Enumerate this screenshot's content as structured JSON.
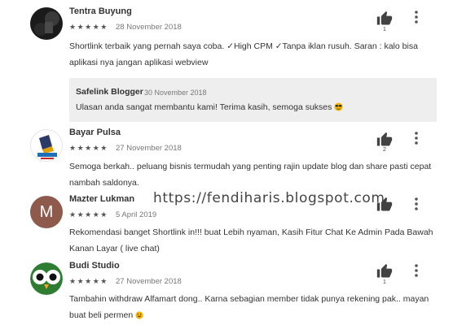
{
  "reviews": [
    {
      "name": "Tentra Buyung",
      "stars": "★★★★★",
      "date": "28 November 2018",
      "text": "Shortlink terbaik yang pernah saya coba. ✓High CPM ✓Tanpa iklan rusuh. Saran : kalo bisa aplikasi nya jangan aplikasi webview",
      "likes": "1",
      "avatar_icon": "dark-photo-avatar"
    },
    {
      "name": "Bayar Pulsa",
      "stars": "★★★★★",
      "date": "27 November 2018",
      "text": "Semoga berkah.. peluang bisnis termudah yang penting rajin update blog dan share pasti cepat nambah saldonya.",
      "likes": "2",
      "avatar_icon": "bayar-pulsa-logo-avatar"
    },
    {
      "name": "Mazter Lukman",
      "stars": "★★★★★",
      "date": "5 April 2019",
      "text": "Rekomendasi banget Shortlink in!!! buat Lebih nyaman, Kasih Fitur Chat Ke Admin Pada Bawah Kanan Layar ( live chat)",
      "likes": "",
      "avatar_letter": "M",
      "avatar_color": "#8d5a4c"
    },
    {
      "name": "Budi Studio",
      "stars": "★★★★★",
      "date": "27 November 2018",
      "text": "Tambahin withdraw Alfamart dong.. Karna sebagian member tidak punya rekening pak.. mayan buat beli permen",
      "likes": "1",
      "avatar_icon": "owl-avatar"
    }
  ],
  "reply": {
    "name": "Safelink Blogger",
    "date": "30 November 2018",
    "text": "Ulasan anda sangat membantu kami! Terima kasih, semoga sukses"
  },
  "watermark": "https://fendiharis.blogspot.com",
  "colors": {
    "accent": "#424242",
    "reply_bg": "#eeeeee"
  }
}
